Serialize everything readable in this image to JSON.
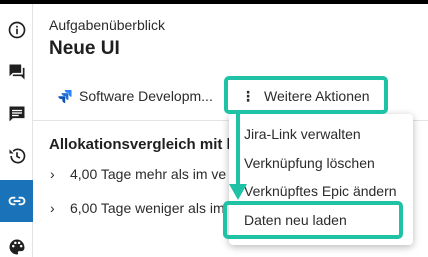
{
  "panel": {
    "subtitle": "Aufgabenüberblick",
    "title": "Neue UI"
  },
  "project": {
    "name": "Software Developm...",
    "icon": "jira-software-icon"
  },
  "actions": {
    "kebab": "⋮",
    "more_label": "Weitere Aktionen"
  },
  "allocation": {
    "title": "Allokationsvergleich mit l",
    "rows": [
      {
        "chevron": "›",
        "text": "4,00 Tage mehr als im ve"
      },
      {
        "chevron": "›",
        "text": "6,00 Tage weniger als im"
      }
    ]
  },
  "menu": {
    "items": [
      {
        "label": "Jira-Link verwalten"
      },
      {
        "label": "Verknüpfung löschen"
      },
      {
        "label": "Verknüpftes Epic ändern"
      },
      {
        "label": "Daten neu laden"
      }
    ]
  },
  "sidebar": {
    "items": [
      {
        "icon": "info-icon"
      },
      {
        "icon": "chat-icon"
      },
      {
        "icon": "comment-icon"
      },
      {
        "icon": "history-icon"
      },
      {
        "icon": "link-icon",
        "active": true
      },
      {
        "icon": "palette-icon"
      }
    ]
  },
  "colors": {
    "highlight": "#20c2a6",
    "sidebar_active": "#1a73b8",
    "jira_blue": "#2684ff"
  }
}
